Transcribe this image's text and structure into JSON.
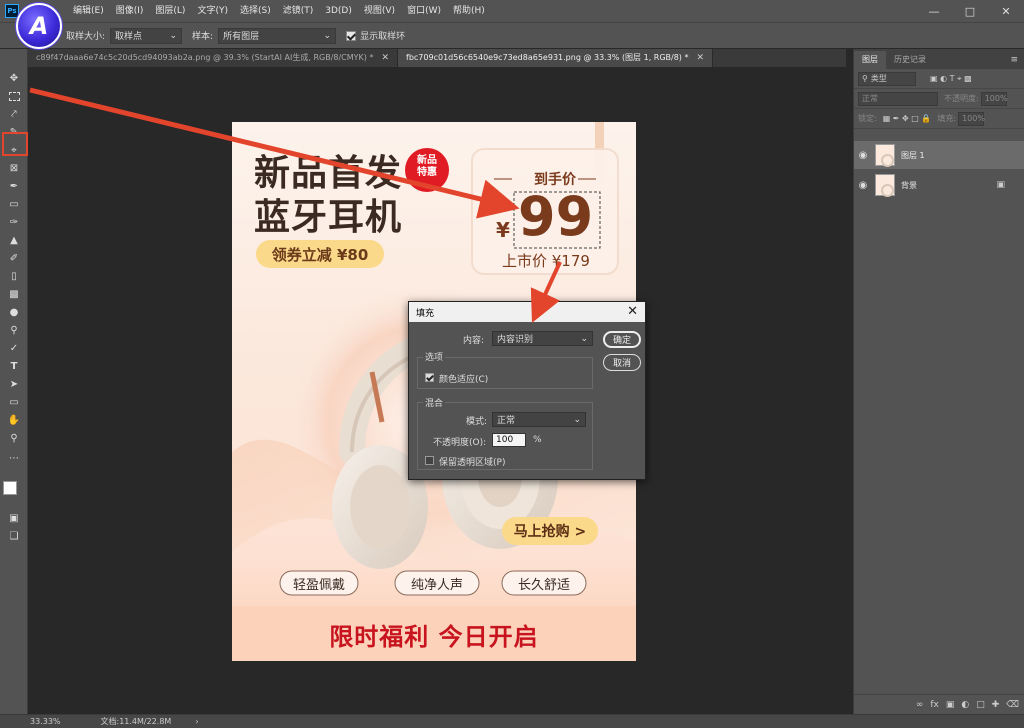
{
  "menubar": {
    "app_icon": "Ps",
    "items": [
      "编辑(E)",
      "图像(I)",
      "图层(L)",
      "文字(Y)",
      "选择(S)",
      "滤镜(T)",
      "3D(D)",
      "视图(V)",
      "窗口(W)",
      "帮助(H)"
    ],
    "logo_letter": "A"
  },
  "options": {
    "sample_size_label": "取样大小:",
    "sample_size_value": "取样点",
    "sample_label": "样本:",
    "sample_value": "所有图层",
    "show_ring_label": "显示取样环",
    "show_ring_checked": true
  },
  "tabs": [
    {
      "label": "c89f47daaa6e74c5c20d5cd94093ab2a.png @ 39.3% (StartAI AI生成, RGB/8/CMYK) *",
      "active": false
    },
    {
      "label": "fbc709c01d56c6540e9c73ed8a65e931.png @ 33.3% (图层 1, RGB/8) *",
      "active": true
    }
  ],
  "poster": {
    "headline_1": "新品首发",
    "headline_2": "蓝牙耳机",
    "badge_1": "新品",
    "badge_2": "特惠",
    "coupon": "领券立减 ¥80",
    "price_label": "到手价",
    "currency": "¥",
    "price": "99",
    "market_price": "上市价 ¥179",
    "buy_button": "马上抢购 >",
    "features": [
      "轻盈佩戴",
      "纯净人声",
      "长久舒适"
    ],
    "banner": "限时福利 今日开启"
  },
  "dialog": {
    "title": "填充",
    "content_label": "内容:",
    "content_value": "内容识别",
    "ok_label": "确定",
    "cancel_label": "取消",
    "options_group": "选项",
    "color_adapt_label": "颜色适应(C)",
    "color_adapt_checked": true,
    "blend_group": "混合",
    "mode_label": "模式:",
    "mode_value": "正常",
    "opacity_label": "不透明度(O):",
    "opacity_value": "100",
    "opacity_unit": "%",
    "preserve_label": "保留透明区域(P)",
    "preserve_checked": false
  },
  "layers_panel": {
    "tabs": [
      "图层",
      "历史记录"
    ],
    "filter_value": "类型",
    "blend_value": "正常",
    "opacity_label": "不透明度:",
    "opacity_value": "100%",
    "lock_label": "锁定:",
    "fill_label": "填充:",
    "fill_value": "100%",
    "layers": [
      {
        "name": "图层 1",
        "selected": true,
        "locked": false
      },
      {
        "name": "背景",
        "selected": false,
        "locked": true
      }
    ]
  },
  "statusbar": {
    "zoom": "33.33%",
    "doc_info": "文档:11.4M/22.8M",
    "arrow": "›"
  },
  "colors": {
    "accent_red": "#e2442c",
    "price_brown": "#7a3a1c",
    "banner_red": "#c8141e"
  }
}
